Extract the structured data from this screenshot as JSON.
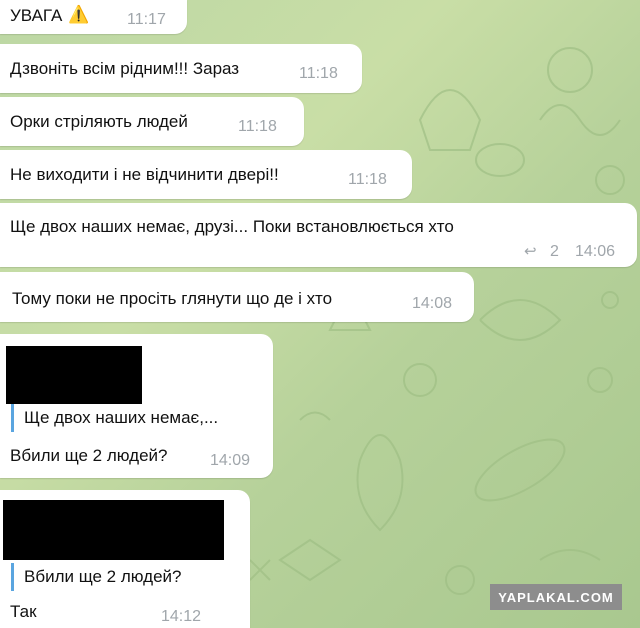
{
  "messages": [
    {
      "text": "УВАГА",
      "emoji": "⚠️",
      "time": "11:17"
    },
    {
      "text": "Дзвоніть всім рідним!!! Зараз",
      "time": "11:18"
    },
    {
      "text": "Орки стріляють людей",
      "time": "11:18"
    },
    {
      "text": "Не виходити і не відчинити двері!!",
      "time": "11:18"
    },
    {
      "text": "Ще двох наших немає, друзі... Поки встановлюється хто",
      "replies": "2",
      "time": "14:06"
    },
    {
      "text": "Тому поки не просіть глянути що де і хто",
      "time": "14:08"
    },
    {
      "quote": "Ще двох наших немає,...",
      "text": "Вбили ще 2 людей?",
      "time": "14:09"
    },
    {
      "quote": "Вбили ще 2 людей?",
      "text": "Так",
      "time": "14:12"
    }
  ],
  "watermark": "YAPLAKAL.COM",
  "colors": {
    "background": "#bcd7a4",
    "bubble": "#ffffff",
    "quote_bar": "#5aa5e0",
    "time": "#a0a6ab"
  }
}
